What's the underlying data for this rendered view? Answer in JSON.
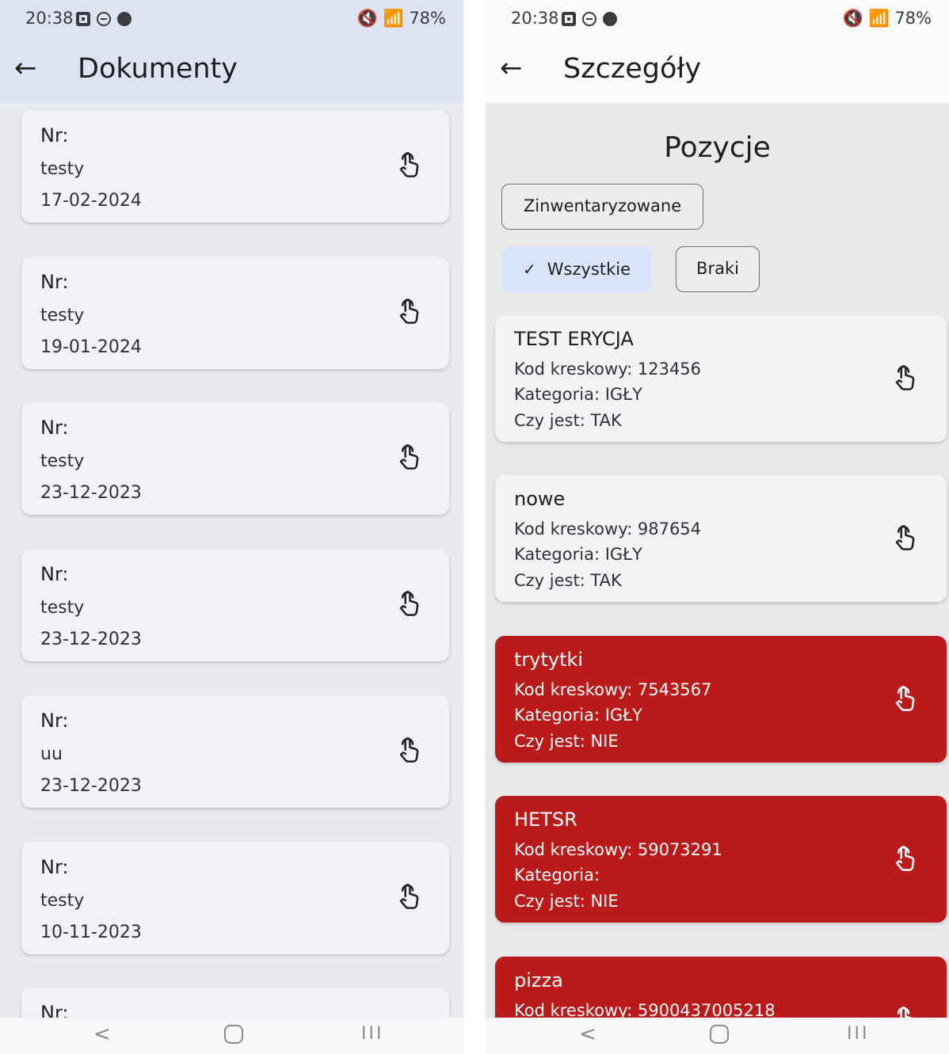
{
  "status": {
    "time": "20:38",
    "right": "🔇 ๑ .ıl78%▮",
    "battery": "78%"
  },
  "left": {
    "title": "Dokumenty",
    "documents": [
      {
        "nr": "Nr:",
        "name": "testy",
        "date": "17-02-2024"
      },
      {
        "nr": "Nr:",
        "name": "testy",
        "date": "19-01-2024"
      },
      {
        "nr": "Nr:",
        "name": "testy",
        "date": "23-12-2023"
      },
      {
        "nr": "Nr:",
        "name": "testy",
        "date": "23-12-2023"
      },
      {
        "nr": "Nr:",
        "name": "uu",
        "date": "23-12-2023"
      },
      {
        "nr": "Nr:",
        "name": "testy",
        "date": "10-11-2023"
      },
      {
        "nr": "Nr:",
        "name": "",
        "date": ""
      }
    ]
  },
  "right": {
    "title": "Szczegóły",
    "section_title": "Pozycje",
    "filters": {
      "inventoried": "Zinwentaryzowane",
      "all": "Wszystkie",
      "missing": "Braki"
    },
    "items": [
      {
        "name": "TEST ERYCJA",
        "barcode": "Kod kreskowy: 123456",
        "category": "Kategoria: IGŁY",
        "present": "Czy jest: TAK"
      },
      {
        "name": "nowe",
        "barcode": "Kod kreskowy: 987654",
        "category": "Kategoria: IGŁY",
        "present": "Czy jest: TAK"
      },
      {
        "name": "trytytki",
        "barcode": "Kod kreskowy: 7543567",
        "category": "Kategoria: IGŁY",
        "present": "Czy jest: NIE"
      },
      {
        "name": "HETSR",
        "barcode": "Kod kreskowy: 59073291",
        "category": "Kategoria:",
        "present": "Czy jest: NIE"
      },
      {
        "name": "pizza",
        "barcode": "Kod kreskowy: 5900437005218",
        "category": "",
        "present": ""
      }
    ]
  },
  "colors": {
    "missing_card": "#ba1a1a",
    "selected_chip": "#dae4f8",
    "appbar_left": "#dde3f1"
  },
  "icons": {
    "back": "arrow-left-icon",
    "tap": "touch-app-icon"
  }
}
